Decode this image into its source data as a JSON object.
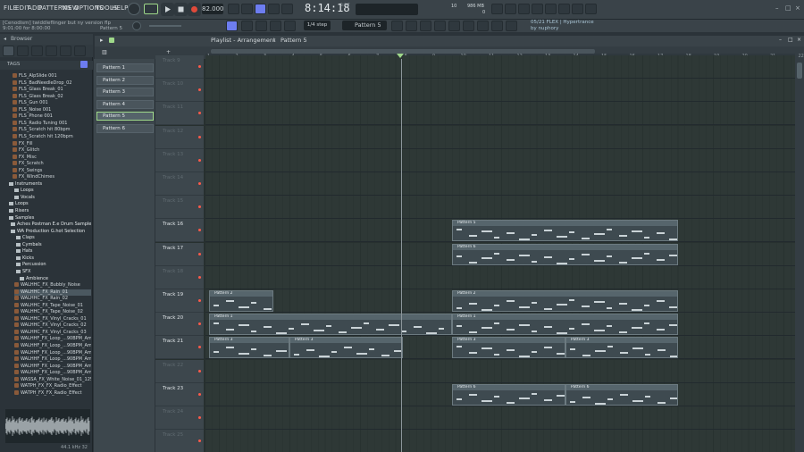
{
  "menu": {
    "file": "FILE",
    "edit": "EDIT",
    "add": "ADD",
    "patterns": "PATTERNS",
    "view": "VIEW",
    "options": "OPTIONS",
    "tools": "TOOLS",
    "help": "HELP"
  },
  "hint": {
    "line1": "[Cenodism] twiddleflinger but ny version flp",
    "line2": "9:01:00 for 8:00:00",
    "pattern": "Pattern 5"
  },
  "transport": {
    "tempo": "82.000",
    "time": "8:14:18",
    "time_label": "B:S:T",
    "cpu": "10",
    "memory": "986 MB",
    "voices": "0"
  },
  "toolbar": {
    "snap": "1/4 step",
    "pattern_selector": "Pattern 5"
  },
  "news": {
    "line1": "05/21  FLEX | Hypertrance",
    "line2": "by nuphory"
  },
  "browser": {
    "title": "Browser",
    "tags_label": "TAGS",
    "items": [
      {
        "label": "FLS_AlpSlide 001",
        "kind": "file"
      },
      {
        "label": "FLS_BadNeedleDrop_02",
        "kind": "file"
      },
      {
        "label": "FLS_Glass Break_01",
        "kind": "file"
      },
      {
        "label": "FLS_Glass Break_02",
        "kind": "file"
      },
      {
        "label": "FLS_Gun 001",
        "kind": "file"
      },
      {
        "label": "FLS_Noise 001",
        "kind": "file"
      },
      {
        "label": "FLS_Phone 001",
        "kind": "file"
      },
      {
        "label": "FLS_Radio Tuning 001",
        "kind": "file"
      },
      {
        "label": "FLS_Scratch hit 80bpm",
        "kind": "file"
      },
      {
        "label": "FLS_Scratch hit 120bpm",
        "kind": "file"
      },
      {
        "label": "FX_Fill",
        "kind": "file"
      },
      {
        "label": "FX_Glitch",
        "kind": "file"
      },
      {
        "label": "FX_Misc",
        "kind": "file"
      },
      {
        "label": "FX_Scratch",
        "kind": "file"
      },
      {
        "label": "FX_Swings",
        "kind": "file"
      },
      {
        "label": "FX_WindChimes",
        "kind": "file"
      },
      {
        "label": "Instruments",
        "kind": "folder"
      },
      {
        "label": "Loops",
        "kind": "folder"
      },
      {
        "label": "Vocals",
        "kind": "folder"
      },
      {
        "label": "Loops",
        "kind": "folder"
      },
      {
        "label": "Risers",
        "kind": "folder"
      },
      {
        "label": "Samples",
        "kind": "folder"
      },
      {
        "label": "Aches Postman E.e Drum Samples",
        "kind": "folder"
      },
      {
        "label": "WA Production G.hot Selection",
        "kind": "folder"
      },
      {
        "label": "Claps",
        "kind": "folder"
      },
      {
        "label": "Cymbals",
        "kind": "folder"
      },
      {
        "label": "Hats",
        "kind": "folder"
      },
      {
        "label": "Kicks",
        "kind": "folder"
      },
      {
        "label": "Percussion",
        "kind": "folder"
      },
      {
        "label": "SFX",
        "kind": "folder"
      },
      {
        "label": "Ambience",
        "kind": "folder"
      },
      {
        "label": "WALHHC_FX_Bubbly_Noise",
        "kind": "file"
      },
      {
        "label": "WALHHC_FX_Rain_01",
        "kind": "file"
      },
      {
        "label": "WALHHC_FX_Rain_02",
        "kind": "file"
      },
      {
        "label": "WALHHC_FX_Tape_Noise_01",
        "kind": "file"
      },
      {
        "label": "WALHHC_FX_Tape_Noise_02",
        "kind": "file"
      },
      {
        "label": "WALHHC_FX_Vinyl_Cracks_01",
        "kind": "file"
      },
      {
        "label": "WALHHC_FX_Vinyl_Cracks_02",
        "kind": "file"
      },
      {
        "label": "WALHHC_FX_Vinyl_Cracks_03",
        "kind": "file"
      },
      {
        "label": "WALHHF_FX_Loop_...90BPM_Ambience",
        "kind": "file"
      },
      {
        "label": "WALHHF_FX_Loop_...90BPM_Ambience",
        "kind": "file"
      },
      {
        "label": "WALHHF_FX_Loop_...90BPM_Ambience",
        "kind": "file"
      },
      {
        "label": "WALHHF_FX_Loop_...90BPM_Ambience",
        "kind": "file"
      },
      {
        "label": "WALHHF_FX_Loop_...90BPM_Ambience",
        "kind": "file"
      },
      {
        "label": "WALHHF_FX_Loop_...90BPM_Ambience",
        "kind": "file"
      },
      {
        "label": "WASSA_FX_White_Noise_01_125BPM",
        "kind": "file"
      },
      {
        "label": "WATPH_FX_FX_Radio_Effect",
        "kind": "file"
      },
      {
        "label": "WATPH_FX_FX_Radio_Effect",
        "kind": "file"
      }
    ],
    "wave_info": "44.1 kHz 32"
  },
  "playlist": {
    "title": "Playlist - Arrangement",
    "breadcrumb_sep": "›",
    "current_pattern": "Pattern 5",
    "ruler": [
      "1",
      "2",
      "3",
      "4",
      "5",
      "6",
      "7",
      "8",
      "9",
      "10",
      "11",
      "12",
      "13",
      "14",
      "15",
      "16",
      "17",
      "18",
      "19",
      "20",
      "21",
      "22"
    ]
  },
  "patterns": [
    "Pattern 1",
    "Pattern 2",
    "Pattern 3",
    "Pattern 4",
    "Pattern 5",
    "Pattern 6"
  ],
  "tracks": [
    {
      "name": "Track 9",
      "active": false
    },
    {
      "name": "Track 10",
      "active": false
    },
    {
      "name": "Track 11",
      "active": false
    },
    {
      "name": "Track 12",
      "active": false
    },
    {
      "name": "Track 13",
      "active": false
    },
    {
      "name": "Track 14",
      "active": false
    },
    {
      "name": "Track 15",
      "active": false
    },
    {
      "name": "Track 16",
      "active": true
    },
    {
      "name": "Track 17",
      "active": true
    },
    {
      "name": "Track 18",
      "active": false
    },
    {
      "name": "Track 19",
      "active": true
    },
    {
      "name": "Track 20",
      "active": true
    },
    {
      "name": "Track 21",
      "active": true
    },
    {
      "name": "Track 22",
      "active": false
    },
    {
      "name": "Track 23",
      "active": true
    },
    {
      "name": "Track 24",
      "active": false
    },
    {
      "name": "Track 25",
      "active": false
    }
  ],
  "clips": [
    {
      "row": 7,
      "label": "Pattern 5"
    },
    {
      "row": 8,
      "label": "Pattern 6"
    },
    {
      "row": 10,
      "label": "Pattern 2"
    },
    {
      "row": 10,
      "label": "Pattern 2"
    },
    {
      "row": 11,
      "label": "Pattern 1"
    },
    {
      "row": 11,
      "label": "Pattern 1"
    },
    {
      "row": 12,
      "label": "Pattern 3"
    },
    {
      "row": 12,
      "label": "Pattern 3"
    },
    {
      "row": 12,
      "label": "Pattern 3"
    },
    {
      "row": 12,
      "label": "Pattern 3"
    },
    {
      "row": 14,
      "label": "Pattern 6"
    },
    {
      "row": 14,
      "label": "Pattern 6"
    }
  ],
  "colors": {
    "accent": "#9fd98a",
    "record": "#e04a3a",
    "time": "#e6ebee",
    "track_led": "#ff5a4a"
  }
}
